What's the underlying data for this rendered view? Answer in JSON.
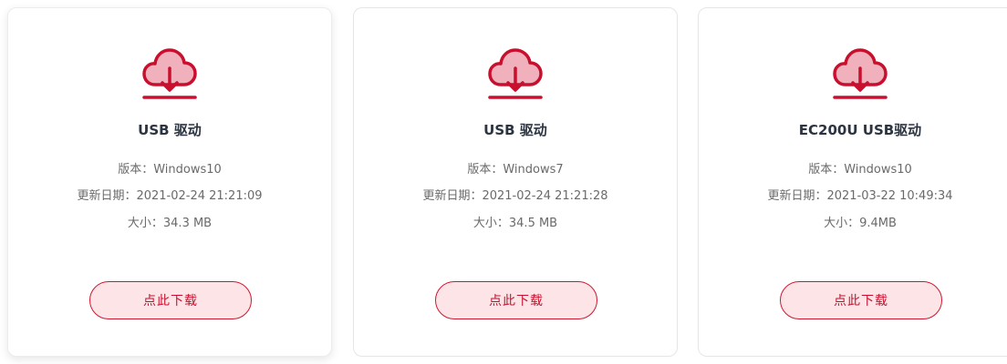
{
  "colors": {
    "accent": "#c8102e",
    "icon_fill": "#f0b0bc",
    "button_bg": "#fde4e7",
    "title_text": "#2b3440",
    "meta_text": "#6a6a6a"
  },
  "cards": [
    {
      "icon": "cloud-download-icon",
      "title": "USB 驱动",
      "version": "版本：Windows10",
      "updated": "更新日期：2021-02-24 21:21:09",
      "size": "大小：34.3 MB",
      "button_label": "点此下载"
    },
    {
      "icon": "cloud-download-icon",
      "title": "USB 驱动",
      "version": "版本：Windows7",
      "updated": "更新日期：2021-02-24 21:21:28",
      "size": "大小：34.5 MB",
      "button_label": "点此下载"
    },
    {
      "icon": "cloud-download-icon",
      "title": "EC200U USB驱动",
      "version": "版本：Windows10",
      "updated": "更新日期：2021-03-22 10:49:34",
      "size": "大小：9.4MB",
      "button_label": "点此下载"
    }
  ]
}
